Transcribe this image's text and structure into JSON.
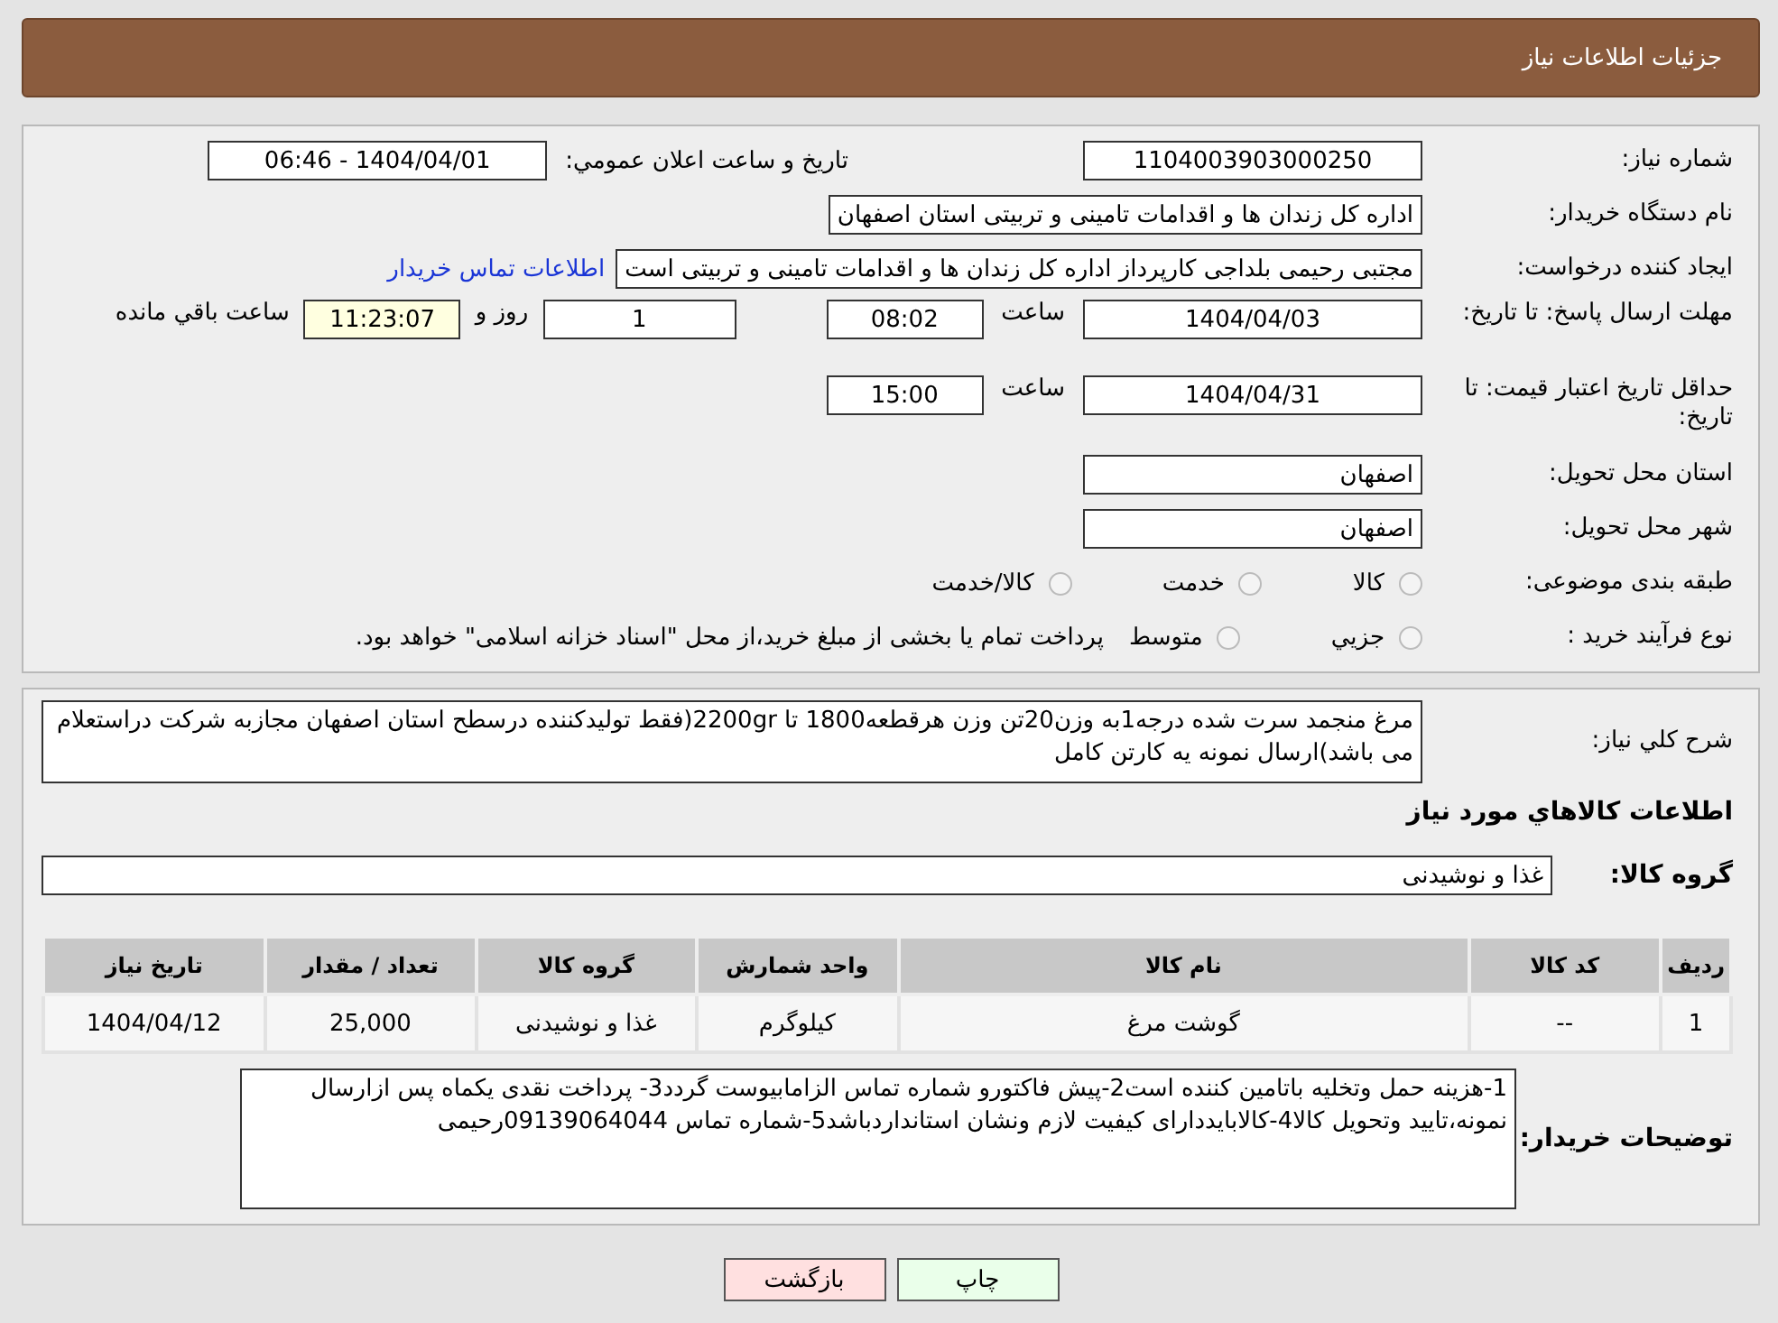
{
  "header": {
    "title": "جزئیات اطلاعات نیاز"
  },
  "need_number": {
    "label": "شماره نیاز:",
    "value": "1104003903000250"
  },
  "announce": {
    "label": "تاريخ و ساعت اعلان عمومي:",
    "value": "1404/04/01 - 06:46"
  },
  "buyer": {
    "label": "نام دستگاه خریدار:",
    "value": "اداره کل زندان ها و اقدامات تامینی و تربیتی استان اصفهان"
  },
  "creator": {
    "label": "ایجاد کننده درخواست:",
    "value": "مجتبی رحیمی بلداجی کارپرداز اداره کل زندان ها و اقدامات تامینی و تربیتی است",
    "link": "اطلاعات تماس خریدار"
  },
  "deadline": {
    "label": "مهلت ارسال پاسخ: تا تاریخ:",
    "date": "1404/04/03",
    "time_label": "ساعت",
    "time": "08:02",
    "days": "1",
    "days_label": "روز و",
    "remaining": "11:23:07",
    "remaining_label": "ساعت باقي مانده"
  },
  "validity": {
    "label": "حداقل تاریخ اعتبار قیمت: تا تاریخ:",
    "date": "1404/04/31",
    "time_label": "ساعت",
    "time": "15:00"
  },
  "province": {
    "label": "استان محل تحویل:",
    "value": "اصفهان"
  },
  "city": {
    "label": "شهر محل تحویل:",
    "value": "اصفهان"
  },
  "category": {
    "label": "طبقه بندی موضوعی:",
    "options": [
      {
        "label": "کالا",
        "selected": false
      },
      {
        "label": "خدمت",
        "selected": false
      },
      {
        "label": "کالا/خدمت",
        "selected": false
      }
    ]
  },
  "process": {
    "label": "نوع فرآیند خرید :",
    "options": [
      {
        "label": "جزیي",
        "selected": false
      },
      {
        "label": "متوسط",
        "selected": false
      }
    ],
    "note": "پرداخت تمام یا بخشی از مبلغ خرید،از محل \"اسناد خزانه اسلامی\" خواهد بود."
  },
  "description": {
    "label": "شرح كلي نياز:",
    "value": "مرغ منجمد سرت شده درجه1به وزن20تن وزن هرقطعه1800 تا 2200gr(فقط تولیدکننده درسطح استان اصفهان مجازبه شرکت دراستعلام می باشد)ارسال نمونه یه کارتن کامل"
  },
  "goods_heading": "اطلاعات كالاهاي مورد نياز",
  "goods_group": {
    "label": "گروه کالا:",
    "value": "غذا و نوشیدنی"
  },
  "table": {
    "columns": [
      "ردیف",
      "کد کالا",
      "نام کالا",
      "واحد شمارش",
      "گروه کالا",
      "تعداد / مقدار",
      "تاریخ نیاز"
    ],
    "rows": [
      [
        "1",
        "--",
        "گوشت مرغ",
        "کیلوگرم",
        "غذا و نوشیدنی",
        "25,000",
        "1404/04/12"
      ]
    ]
  },
  "buyer_notes": {
    "label": "توضیحات خریدار:",
    "value": "1-هزینه حمل وتخلیه باتامین کننده است2-پیش فاکتورو شماره تماس الزامابیوست گردد3- پرداخت نقدی یکماه  پس ازارسال نمونه،تایید وتحویل کالا4-کالابایددارای کیفیت لازم ونشان استانداردباشد5-شماره تماس 09139064044رحیمی"
  },
  "buttons": [
    {
      "kind": "print",
      "label": "چاپ"
    },
    {
      "kind": "back",
      "label": "بازگشت"
    }
  ]
}
